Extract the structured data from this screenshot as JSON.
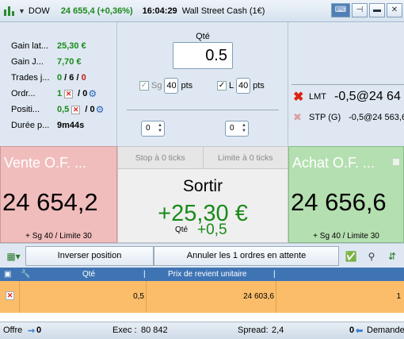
{
  "title_bar": {
    "symbol": "DOW",
    "price": "24 655,4 (+0,36%)",
    "time": "16:04:29",
    "name": "Wall Street Cash (1€)"
  },
  "info": {
    "rows": [
      {
        "label": "Gain lat...",
        "value": "25,30 €"
      },
      {
        "label": "Gain J...",
        "value": "7,70 €"
      },
      {
        "label": "Trades j...",
        "value_a": "0",
        "value_b": "6",
        "value_c": "0"
      },
      {
        "label": "Ordr...",
        "value_a": "1",
        "value_b": "0"
      },
      {
        "label": "Positi...",
        "value_a": "0,5",
        "value_b": "0"
      },
      {
        "label": "Durée p...",
        "value": "9m44s"
      }
    ]
  },
  "order": {
    "qty_label": "Qté",
    "qty_value": "0.5",
    "sg_label": "Sg",
    "sg_pts": "40",
    "l_label": "L",
    "l_pts": "40",
    "pts_unit": "pts",
    "spin_left": "0",
    "spin_right": "0"
  },
  "pending": {
    "lmt_label": "LMT",
    "lmt_value": "-0,5@24 64",
    "stp_label": "STP (G)",
    "stp_value": "-0,5@24 563,6"
  },
  "sell": {
    "title": "Vente O.F. ...",
    "price": "24 654,2",
    "footer": "+ Sg 40 / Limite 30"
  },
  "buy": {
    "title": "Achat O.F. ...",
    "price": "24 656,6",
    "footer": "+ Sg 40 / Limite 30"
  },
  "middle": {
    "stop_btn": "Stop à 0 ticks",
    "limit_btn": "Limite à 0 ticks",
    "exit_label": "Sortir",
    "pnl": "+25,30 €",
    "qty_label": "Qté",
    "qty_value": "+0,5"
  },
  "toolbar": {
    "reverse": "Inverser position",
    "cancel": "Annuler les 1 ordres en attente"
  },
  "grid": {
    "headers": {
      "qty": "Qté",
      "cost": "Prix de revient unitaire"
    },
    "row": {
      "qty": "0,5",
      "cost": "24 603,6",
      "count": "1"
    }
  },
  "status": {
    "offer_label": "Offre",
    "offer_value": "0",
    "exec_label": "Exec :",
    "exec_value": "80 842",
    "spread_label": "Spread:",
    "spread_value": "2,4",
    "demand_value": "0",
    "demand_label": "Demande"
  },
  "colors": {
    "positive": "#1a8a1a",
    "negative": "#c81a1a",
    "sell_bg": "#f0bcbc",
    "buy_bg": "#b4dfb0",
    "grid_row": "#fbbd6a",
    "grid_header": "#3f74b4"
  }
}
